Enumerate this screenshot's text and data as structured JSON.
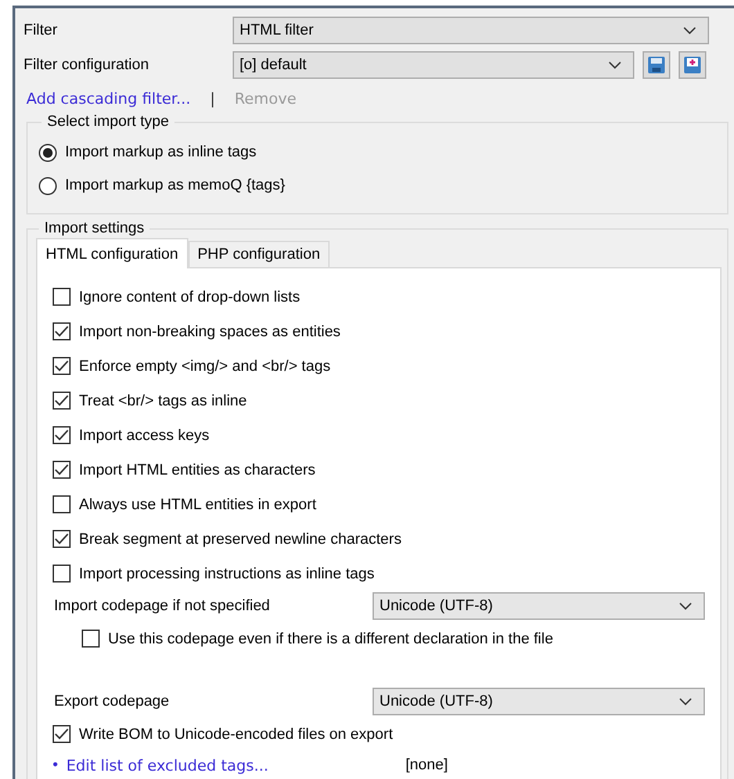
{
  "filter": {
    "label": "Filter",
    "value": "HTML filter"
  },
  "filter_configuration": {
    "label": "Filter configuration",
    "value": "[o] default"
  },
  "links": {
    "add": "Add cascading filter...",
    "separator": "|",
    "remove": "Remove",
    "remove_disabled": true
  },
  "import_type": {
    "title": "Select import type",
    "options": [
      {
        "label": "Import markup as inline tags",
        "selected": true
      },
      {
        "label": "Import markup as memoQ {tags}",
        "selected": false
      }
    ]
  },
  "import_settings": {
    "title": "Import settings",
    "tabs": [
      {
        "label": "HTML configuration",
        "selected": true
      },
      {
        "label": "PHP configuration",
        "selected": false
      }
    ],
    "options": [
      {
        "label": "Ignore content of drop-down lists",
        "checked": false
      },
      {
        "label": "Import non-breaking spaces as entities",
        "checked": true
      },
      {
        "label": "Enforce empty <img/> and <br/> tags",
        "checked": true
      },
      {
        "label": "Treat <br/> tags as inline",
        "checked": true
      },
      {
        "label": "Import access keys",
        "checked": true
      },
      {
        "label": "Import HTML entities as characters",
        "checked": true
      },
      {
        "label": "Always use HTML entities in export",
        "checked": false
      },
      {
        "label": "Break segment at preserved newline characters",
        "checked": true
      },
      {
        "label": "Import processing instructions as inline tags",
        "checked": false
      }
    ],
    "import_codepage": {
      "label": "Import codepage if not specified",
      "value": "Unicode (UTF-8)"
    },
    "force_codepage": {
      "label": "Use this codepage even if there is a different declaration in the file",
      "checked": false
    },
    "export_codepage": {
      "label": "Export codepage",
      "value": "Unicode (UTF-8)"
    },
    "write_bom": {
      "label": "Write BOM to Unicode-encoded files on export",
      "checked": true
    },
    "excluded_tags": {
      "bullet": "•",
      "link": "Edit list of excluded tags...",
      "value": "[none]"
    }
  }
}
